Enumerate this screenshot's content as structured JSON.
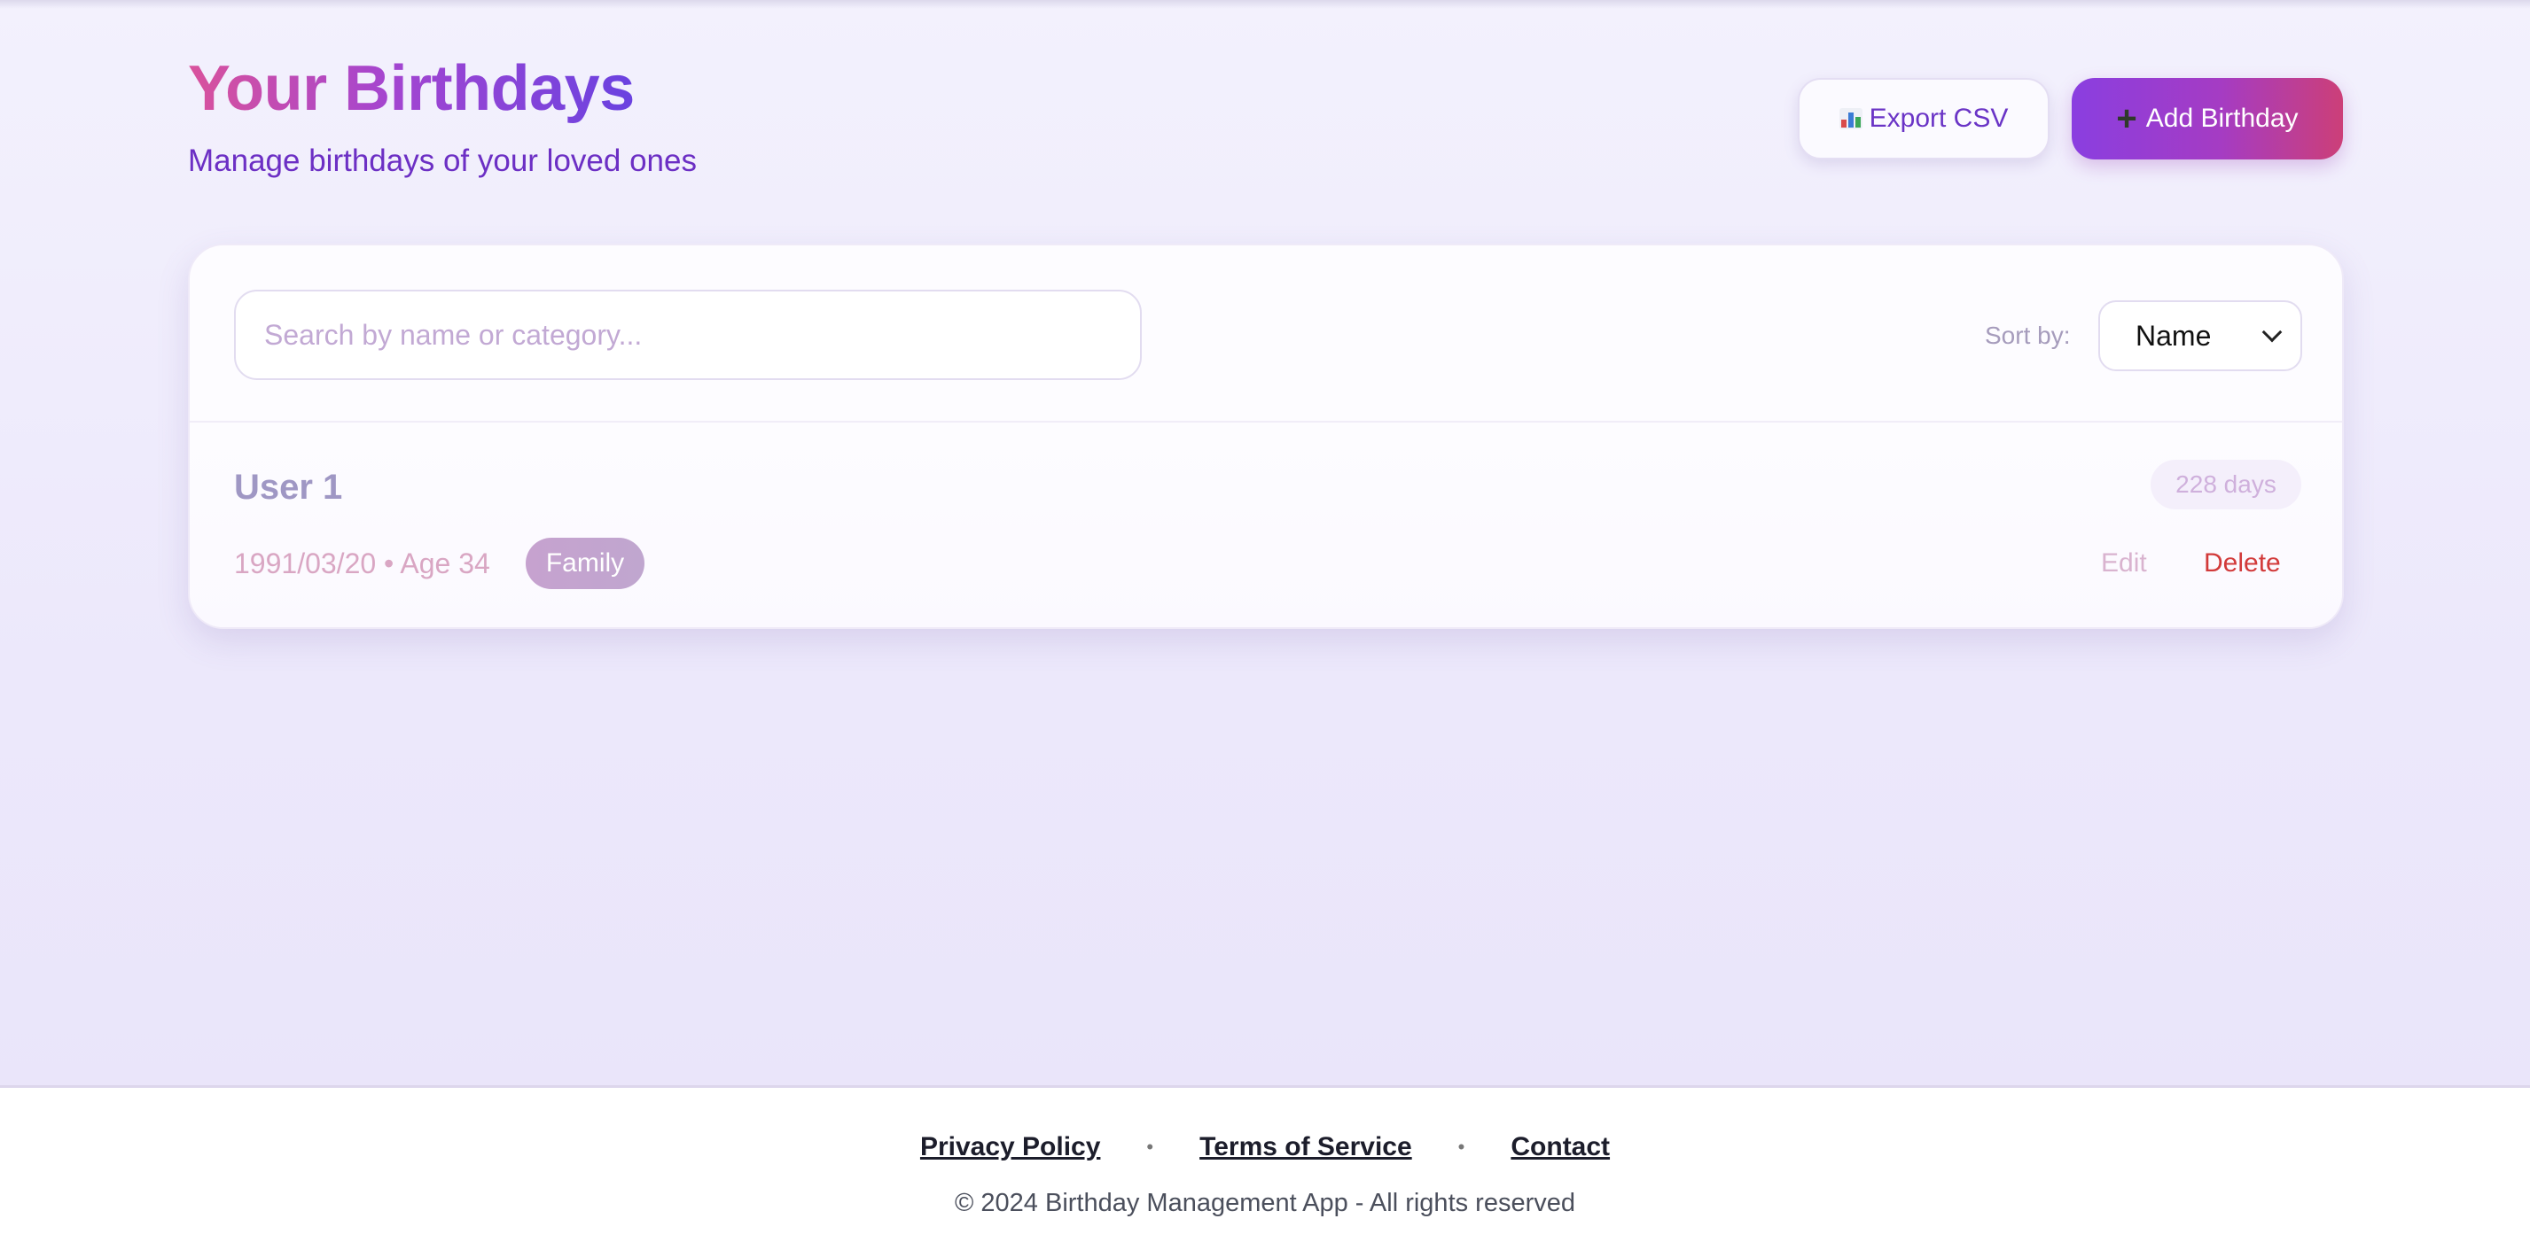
{
  "header": {
    "title": "Your Birthdays",
    "subtitle": "Manage birthdays of your loved ones"
  },
  "actions": {
    "export_label": "Export CSV",
    "export_icon": "bar-chart-icon",
    "add_label": "Add Birthday",
    "add_icon": "plus-icon"
  },
  "controls": {
    "search_placeholder": "Search by name or category...",
    "search_value": "",
    "sort_label": "Sort by:",
    "sort_selected": "Name"
  },
  "birthdays": [
    {
      "name": "User 1",
      "date": "1991/03/20",
      "separator": "•",
      "age": "Age 34",
      "category": "Family",
      "days_until": "228 days",
      "edit_label": "Edit",
      "delete_label": "Delete"
    }
  ],
  "footer": {
    "links": [
      "Privacy Policy",
      "Terms of Service",
      "Contact"
    ],
    "separator": "•",
    "copyright": "© 2024 Birthday Management App - All rights reserved"
  },
  "colors": {
    "title_gradient_start": "#d9529c",
    "title_gradient_end": "#6a42e0",
    "subtitle": "#6c2fc4",
    "add_button_start": "#8a3ee0",
    "add_button_end": "#cc3f78",
    "delete": "#d23a3a"
  }
}
